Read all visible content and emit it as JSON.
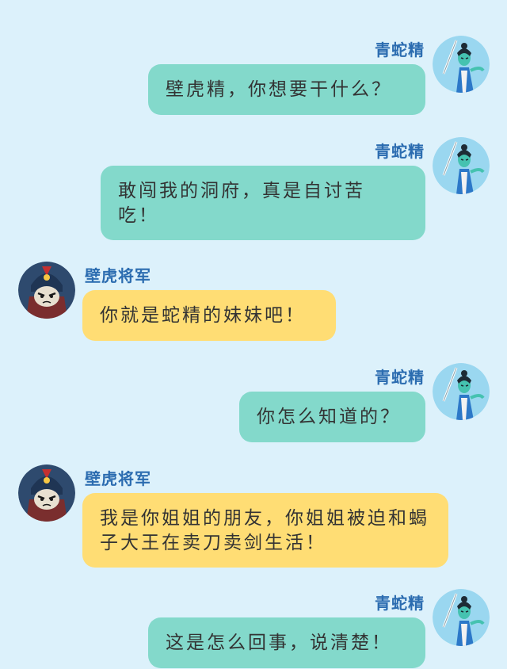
{
  "characters": {
    "snake": {
      "name": "青蛇精",
      "bubble_color": "#83d9cb"
    },
    "gecko": {
      "name": "壁虎将军",
      "bubble_color": "#ffdd74"
    }
  },
  "messages": [
    {
      "speaker": "snake",
      "name": "青蛇精",
      "text": "壁虎精，你想要干什么？"
    },
    {
      "speaker": "snake",
      "name": "青蛇精",
      "text": "敢闯我的洞府，真是自讨苦吃！"
    },
    {
      "speaker": "gecko",
      "name": "壁虎将军",
      "text": "你就是蛇精的妹妹吧！"
    },
    {
      "speaker": "snake",
      "name": "青蛇精",
      "text": "你怎么知道的？"
    },
    {
      "speaker": "gecko",
      "name": "壁虎将军",
      "text": "我是你姐姐的朋友，你姐姐被迫和蝎子大王在卖刀卖剑生活！"
    },
    {
      "speaker": "snake",
      "name": "青蛇精",
      "text": "这是怎么回事，说清楚！"
    }
  ]
}
